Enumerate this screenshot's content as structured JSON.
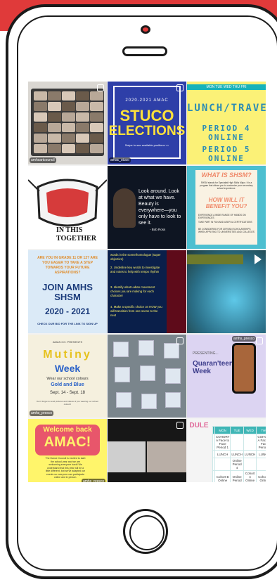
{
  "colors": {
    "accent": "#e03a3a",
    "blue": "#2e3fa8",
    "yellow": "#fbf177",
    "teal": "#17b2b9"
  },
  "feed": {
    "t1": {
      "tag": "amhsartcouncil",
      "icon": "carousel-icon"
    },
    "t2": {
      "line1": "2020-2021 AMAC",
      "line2": "STUCO",
      "line3": "ELECTIONS",
      "sub": "Swipe to see available positions >>",
      "tag": "amac_stuco",
      "icon": "carousel-icon"
    },
    "t3": {
      "top": "MON  TUE  WED  THU  FRI",
      "l1": "LUNCH/TRAVEL",
      "l2": "PERIOD 4 ONLINE",
      "l3": "PERIOD 5 ONLINE"
    },
    "t4": {
      "title": "IN THIS",
      "title2": "TOGETHER"
    },
    "t5": {
      "quote": "Look around. Look at what we have. Beauty is everywhere—you only have to look to see it.",
      "by": "- Bob Ross"
    },
    "t6": {
      "h1": "WHAT IS SHSM?",
      "body": "SHSM stands for Specialist High Skills Major. It is a program that allows you to customize your secondary school experience.",
      "h2": "HOW WILL IT BENEFIT YOU?",
      "b1": "EXPERIENCE A WIDE RANGE OF HANDS ON EXPERIENCES",
      "b2": "TAKE PART IN FUN AND USEFUL CERTIFICATIONS",
      "b3": "BE CONSIDERED FOR CERTAIN SCHOLARSHIPS WHEN APPLYING TO UNIVERSITIES AND COLLEGES"
    },
    "t7": {
      "q": "ARE YOU IN GRADE 11 OR 12? ARE YOU EAGER TO TAKE A STEP TOWARDS YOUR FUTURE ASPIRATIONS?",
      "h": "JOIN AMHS SHSM",
      "yr": "2020 - 2021",
      "cta": "CHECK OUR BIO FOR THE LINK TO SIGN UP"
    },
    "t8": {
      "a": "words in the scene/homologue (super objective)",
      "b": "2. Underline key words to investigate and notes to help with tempo rhythm",
      "c": "3. Identify what Laban movement choices you are making for each character",
      "d": "4. Make a specific choice on HOW you will transition from one scene to the next"
    },
    "t9": {
      "icon": "play-icon"
    },
    "t10": {
      "pre": "AMAS.CO. PRESENTS",
      "w1": "Mutiny",
      "w2": "Week",
      "s1": "Wear our school colours",
      "s2": "Gold and Blue",
      "dates": "Sept. 14 - Sept. 18",
      "fine": "Don't forget to send pictures and videos of you wearing our school colours!",
      "tag": "amhs_presco"
    },
    "t11": {
      "icon": "carousel-icon"
    },
    "t12": {
      "pre": "PRESENTING...",
      "h": "Quaran'teen' Week",
      "tag": "amhs_presco",
      "icon": "carousel-icon"
    },
    "t13": {
      "h1": "Welcome back",
      "h2": "AMAC!",
      "body": "The Dance Council is excited to start the school year and we are welcoming everyone back! We understand that this year will be a little different, but we've adapted our events so everyone can participate online and in person.",
      "tag": "amhs_presco"
    },
    "t14": {
      "icon": "carousel-icon"
    },
    "t15": {
      "title": "DULE",
      "headers": [
        "",
        "MON",
        "TUE",
        "WED",
        "THU"
      ],
      "rows": [
        [
          "",
          "COHORT A Face to Face Period 1",
          "",
          "",
          "COHORT A Face to Face Period 1"
        ],
        [
          "",
          "LUNCH",
          "LUNCH",
          "LUNCH",
          "LUNCH"
        ],
        [
          "",
          "",
          "Online Period 4",
          "",
          ""
        ],
        [
          "",
          "Cohort B Online Period 1",
          "Online Period 5",
          "Cohort A Online Period 4",
          "Cohort B Online Period 1"
        ],
        [
          "",
          "Cohort A Online Period 5",
          "Online Period 5",
          "",
          "Cohort A Online Period 5"
        ]
      ]
    }
  }
}
